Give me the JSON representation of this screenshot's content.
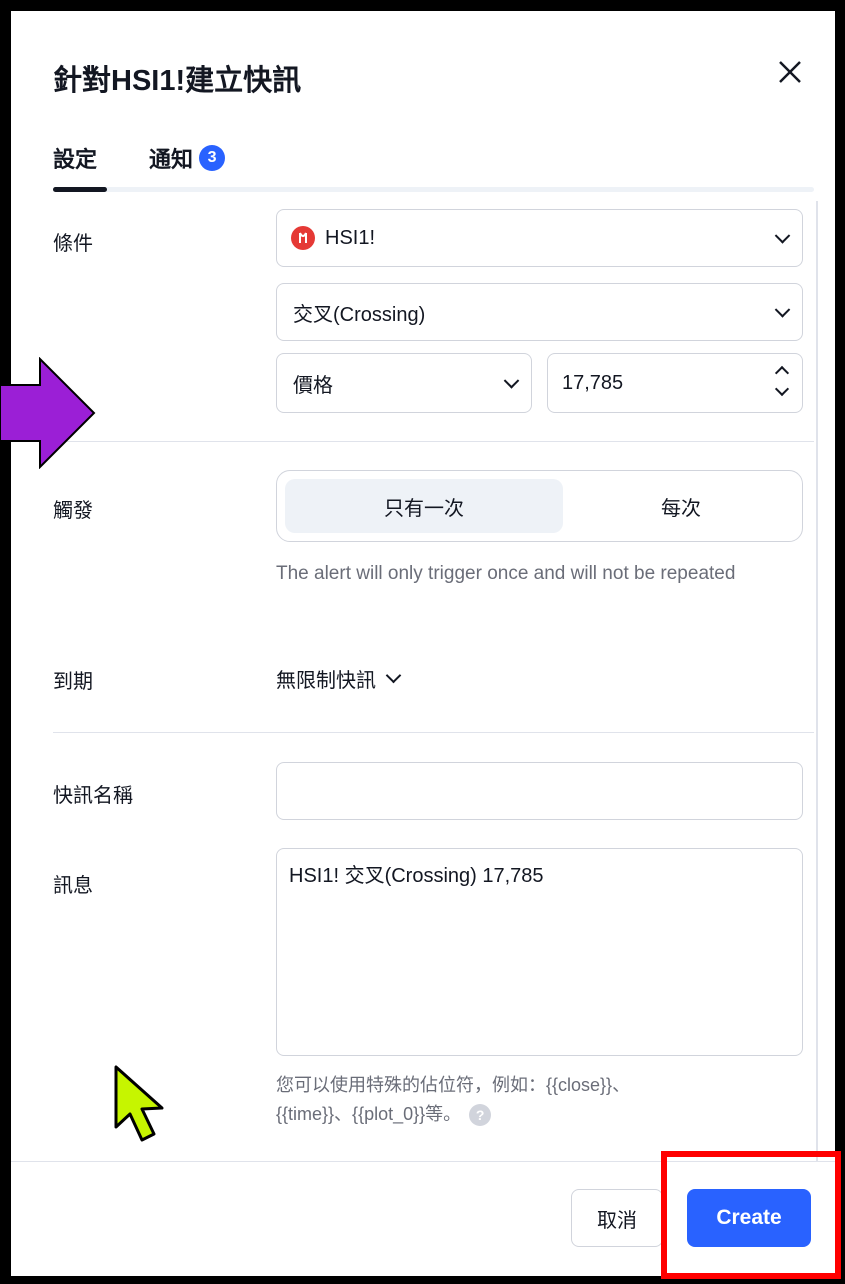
{
  "dialog": {
    "title": "針對HSI1!建立快訊"
  },
  "tabs": {
    "settings": "設定",
    "notifications": "通知",
    "notifications_count": "3"
  },
  "condition": {
    "label": "條件",
    "symbol": "HSI1!",
    "operator": "交叉(Crossing)",
    "source": "價格",
    "value": "17,785"
  },
  "trigger": {
    "label": "觸發",
    "once": "只有一次",
    "every": "每次",
    "helper": "The alert will only trigger once and will not be repeated"
  },
  "expiration": {
    "label": "到期",
    "value": "無限制快訊"
  },
  "alert_name": {
    "label": "快訊名稱",
    "value": ""
  },
  "message": {
    "label": "訊息",
    "value": "HSI1! 交叉(Crossing) 17,785",
    "helper_line1": "您可以使用特殊的佔位符，例如：{{close}}、",
    "helper_line2": "{{time}}、{{plot_0}}等。"
  },
  "footer": {
    "cancel": "取消",
    "create": "Create"
  },
  "colors": {
    "accent": "#2962ff",
    "annotation_arrow": "#9b1fd6",
    "annotation_cursor": "#c6f500",
    "highlight": "#ff0000"
  }
}
